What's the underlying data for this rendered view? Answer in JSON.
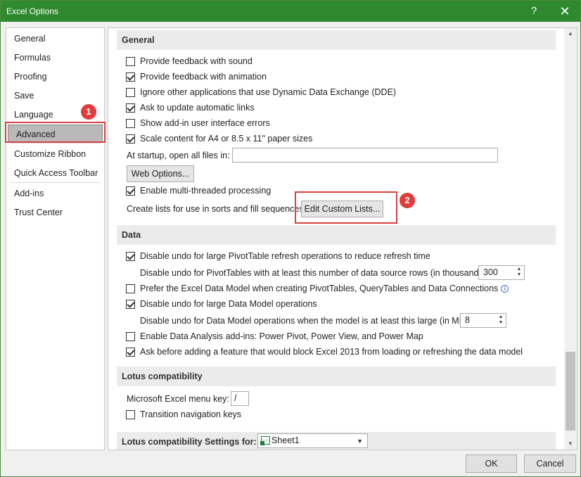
{
  "window": {
    "title": "Excel Options",
    "help_glyph": "?",
    "close_glyph": "✕"
  },
  "sidebar": {
    "items": [
      {
        "label": "General"
      },
      {
        "label": "Formulas"
      },
      {
        "label": "Proofing"
      },
      {
        "label": "Save"
      },
      {
        "label": "Language"
      },
      {
        "label": "Advanced",
        "selected": true
      },
      {
        "label": "Customize Ribbon"
      },
      {
        "label": "Quick Access Toolbar"
      },
      {
        "label": "Add-ins"
      },
      {
        "label": "Trust Center"
      }
    ]
  },
  "callouts": {
    "one": "1",
    "two": "2",
    "color": "#d9413e"
  },
  "general": {
    "header": "General",
    "options": [
      {
        "label": "Provide feedback with sound",
        "checked": false
      },
      {
        "label": "Provide feedback with animation",
        "checked": true
      },
      {
        "label": "Ignore other applications that use Dynamic Data Exchange (DDE)",
        "checked": false
      },
      {
        "label": "Ask to update automatic links",
        "checked": true
      },
      {
        "label": "Show add-in user interface errors",
        "checked": false
      },
      {
        "label": "Scale content for A4 or 8.5 x 11\" paper sizes",
        "checked": true
      }
    ],
    "startup_label": "At startup, open all files in:",
    "startup_value": "",
    "web_options_button": "Web Options...",
    "multithread_label": "Enable multi-threaded processing",
    "multithread_checked": true,
    "custom_lists_label": "Create lists for use in sorts and fill sequences:",
    "custom_lists_button": "Edit Custom Lists..."
  },
  "data_section": {
    "header": "Data",
    "undo_pivot_label": "Disable undo for large PivotTable refresh operations to reduce refresh time",
    "undo_pivot_checked": true,
    "undo_pivot_rows_label": "Disable undo for PivotTables with at least this number of data source rows (in thousands):",
    "undo_pivot_rows_value": "300",
    "prefer_model_label": "Prefer the Excel Data Model when creating PivotTables, QueryTables and Data Connections",
    "prefer_model_checked": false,
    "undo_model_label": "Disable undo for large Data Model operations",
    "undo_model_checked": true,
    "undo_model_size_label": "Disable undo for Data Model operations when the model is at least this large (in MB):",
    "undo_model_size_value": "8",
    "analysis_addins_label": "Enable Data Analysis add-ins: Power Pivot, Power View, and Power Map",
    "analysis_addins_checked": false,
    "ask_before_label": "Ask before adding a feature that would block Excel 2013 from loading or refreshing the data model",
    "ask_before_checked": true
  },
  "lotus": {
    "header": "Lotus compatibility",
    "menu_key_label": "Microsoft Excel menu key:",
    "menu_key_value": "/",
    "transition_label": "Transition navigation keys",
    "transition_checked": false
  },
  "lotus_settings": {
    "header": "Lotus compatibility Settings for:",
    "sheet_value": "Sheet1"
  },
  "footer": {
    "ok": "OK",
    "cancel": "Cancel"
  }
}
